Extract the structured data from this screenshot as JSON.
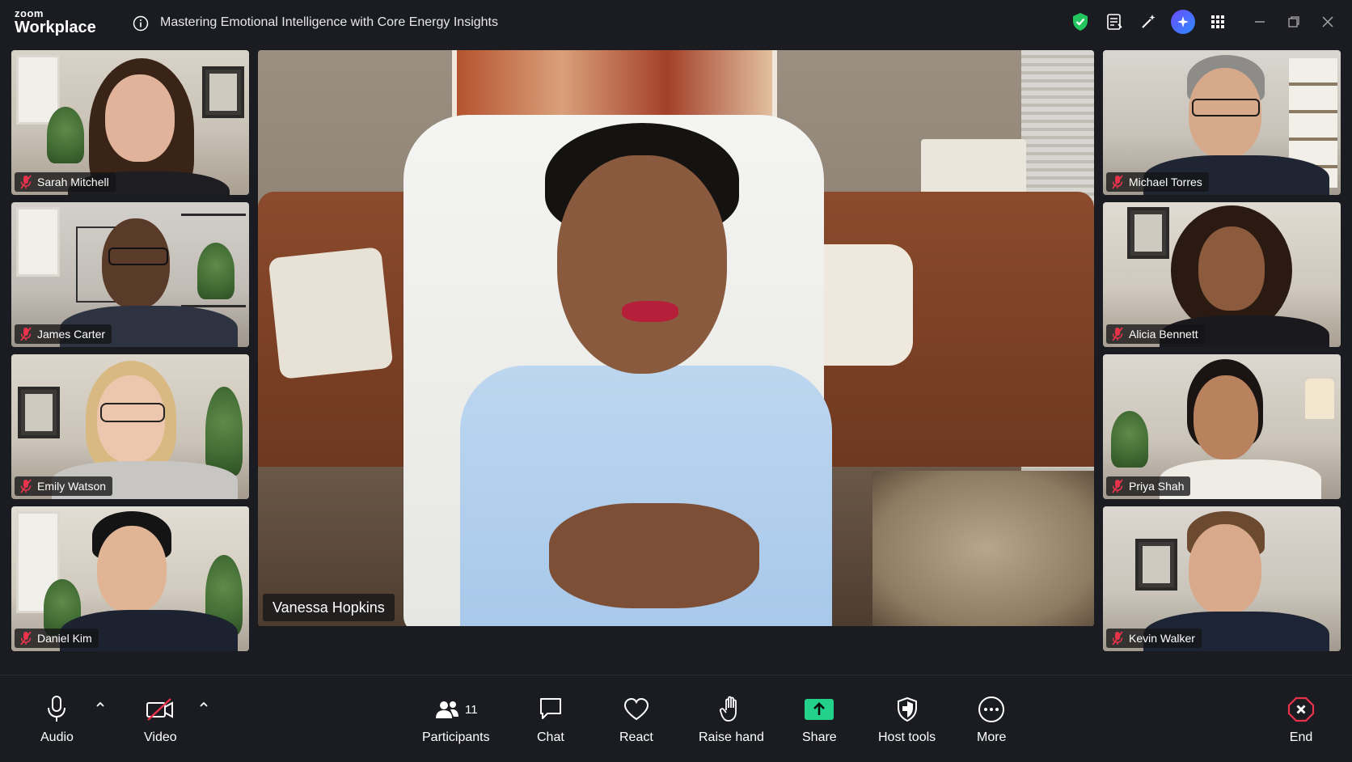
{
  "app": {
    "brand_top": "zoom",
    "brand_bottom": "Workplace"
  },
  "meeting": {
    "title": "Mastering Emotional Intelligence with Core Energy Insights"
  },
  "titlebar_icons": [
    "shield-check-icon",
    "notes-icon",
    "wand-icon",
    "ai-companion-icon",
    "apps-grid-icon",
    "minimize-icon",
    "restore-icon",
    "close-icon"
  ],
  "speaker": {
    "name": "Vanessa Hopkins"
  },
  "participants_left": [
    {
      "name": "Sarah Mitchell",
      "muted": true
    },
    {
      "name": "James Carter",
      "muted": true
    },
    {
      "name": "Emily Watson",
      "muted": true
    },
    {
      "name": "Daniel Kim",
      "muted": true
    }
  ],
  "participants_right": [
    {
      "name": "Michael Torres",
      "muted": true
    },
    {
      "name": "Alicia Bennett",
      "muted": true
    },
    {
      "name": "Priya Shah",
      "muted": true
    },
    {
      "name": "Kevin Walker",
      "muted": true
    }
  ],
  "toolbar": {
    "audio": "Audio",
    "video": "Video",
    "participants": "Participants",
    "participants_count": "11",
    "chat": "Chat",
    "react": "React",
    "raise_hand": "Raise hand",
    "share": "Share",
    "host_tools": "Host tools",
    "more": "More",
    "end": "End"
  },
  "colors": {
    "background": "#1a1c21",
    "share_green": "#23d18b",
    "end_red": "#e8334a",
    "muted_red": "#e8334a"
  }
}
